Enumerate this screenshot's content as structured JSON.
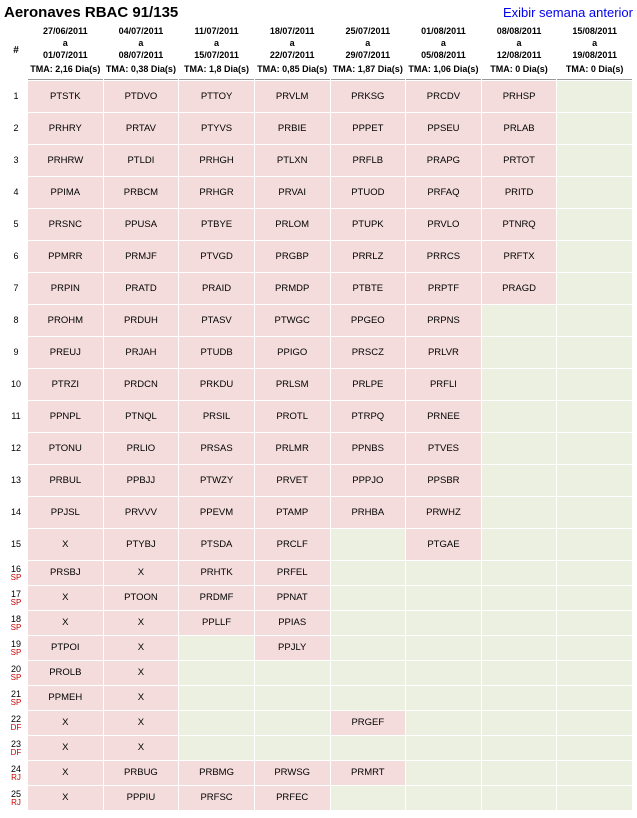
{
  "title": "Aeronaves RBAC 91/135",
  "prev_link": "Exibir semana anterior",
  "columns": [
    {
      "from": "27/06/2011",
      "to": "01/07/2011",
      "tma": "TMA: 2,16 Dia(s)"
    },
    {
      "from": "04/07/2011",
      "to": "08/07/2011",
      "tma": "TMA: 0,38 Dia(s)"
    },
    {
      "from": "11/07/2011",
      "to": "15/07/2011",
      "tma": "TMA: 1,8 Dia(s)"
    },
    {
      "from": "18/07/2011",
      "to": "22/07/2011",
      "tma": "TMA: 0,85 Dia(s)"
    },
    {
      "from": "25/07/2011",
      "to": "29/07/2011",
      "tma": "TMA: 1,87 Dia(s)"
    },
    {
      "from": "01/08/2011",
      "to": "05/08/2011",
      "tma": "TMA: 1,06 Dia(s)"
    },
    {
      "from": "08/08/2011",
      "to": "12/08/2011",
      "tma": "TMA: 0 Dia(s)"
    },
    {
      "from": "15/08/2011",
      "to": "19/08/2011",
      "tma": "TMA: 0 Dia(s)"
    }
  ],
  "rows": [
    {
      "n": "1",
      "reg": "",
      "size": "big",
      "cells": [
        "PTSTK",
        "PTDVO",
        "PTTOY",
        "PRVLM",
        "PRKSG",
        "PRCDV",
        "PRHSP",
        ""
      ]
    },
    {
      "n": "2",
      "reg": "",
      "size": "big",
      "cells": [
        "PRHRY",
        "PRTAV",
        "PTYVS",
        "PRBIE",
        "PPPET",
        "PPSEU",
        "PRLAB",
        ""
      ]
    },
    {
      "n": "3",
      "reg": "",
      "size": "big",
      "cells": [
        "PRHRW",
        "PTLDI",
        "PRHGH",
        "PTLXN",
        "PRFLB",
        "PRAPG",
        "PRTOT",
        ""
      ]
    },
    {
      "n": "4",
      "reg": "",
      "size": "big",
      "cells": [
        "PPIMA",
        "PRBCM",
        "PRHGR",
        "PRVAI",
        "PTUOD",
        "PRFAQ",
        "PRITD",
        ""
      ]
    },
    {
      "n": "5",
      "reg": "",
      "size": "big",
      "cells": [
        "PRSNC",
        "PPUSA",
        "PTBYE",
        "PRLOM",
        "PTUPK",
        "PRVLO",
        "PTNRQ",
        ""
      ]
    },
    {
      "n": "6",
      "reg": "",
      "size": "big",
      "cells": [
        "PPMRR",
        "PRMJF",
        "PTVGD",
        "PRGBP",
        "PRRLZ",
        "PRRCS",
        "PRFTX",
        ""
      ]
    },
    {
      "n": "7",
      "reg": "",
      "size": "big",
      "cells": [
        "PRPIN",
        "PRATD",
        "PRAID",
        "PRMDP",
        "PTBTE",
        "PRPTF",
        "PRAGD",
        ""
      ]
    },
    {
      "n": "8",
      "reg": "",
      "size": "big",
      "cells": [
        "PROHM",
        "PRDUH",
        "PTASV",
        "PTWGC",
        "PPGEO",
        "PRPNS",
        "",
        ""
      ]
    },
    {
      "n": "9",
      "reg": "",
      "size": "big",
      "cells": [
        "PREUJ",
        "PRJAH",
        "PTUDB",
        "PPIGO",
        "PRSCZ",
        "PRLVR",
        "",
        ""
      ]
    },
    {
      "n": "10",
      "reg": "",
      "size": "big",
      "cells": [
        "PTRZI",
        "PRDCN",
        "PRKDU",
        "PRLSM",
        "PRLPE",
        "PRFLI",
        "",
        ""
      ]
    },
    {
      "n": "11",
      "reg": "",
      "size": "big",
      "cells": [
        "PPNPL",
        "PTNQL",
        "PRSIL",
        "PROTL",
        "PTRPQ",
        "PRNEE",
        "",
        ""
      ]
    },
    {
      "n": "12",
      "reg": "",
      "size": "big",
      "cells": [
        "PTONU",
        "PRLIO",
        "PRSAS",
        "PRLMR",
        "PPNBS",
        "PTVES",
        "",
        ""
      ]
    },
    {
      "n": "13",
      "reg": "",
      "size": "big",
      "cells": [
        "PRBUL",
        "PPBJJ",
        "PTWZY",
        "PRVET",
        "PPPJO",
        "PPSBR",
        "",
        ""
      ]
    },
    {
      "n": "14",
      "reg": "",
      "size": "big",
      "cells": [
        "PPJSL",
        "PRVVV",
        "PPEVM",
        "PTAMP",
        "PRHBA",
        "PRWHZ",
        "",
        ""
      ]
    },
    {
      "n": "15",
      "reg": "",
      "size": "big",
      "cells": [
        "X",
        "PTYBJ",
        "PTSDA",
        "PRCLF",
        "",
        "PTGAE",
        "",
        ""
      ]
    },
    {
      "n": "16",
      "reg": "SP",
      "size": "small",
      "cells": [
        "PRSBJ",
        "X",
        "PRHTK",
        "PRFEL",
        "",
        "",
        "",
        ""
      ]
    },
    {
      "n": "17",
      "reg": "SP",
      "size": "small",
      "cells": [
        "X",
        "PTOON",
        "PRDMF",
        "PPNAT",
        "",
        "",
        "",
        ""
      ]
    },
    {
      "n": "18",
      "reg": "SP",
      "size": "small",
      "cells": [
        "X",
        "X",
        "PPLLF",
        "PPIAS",
        "",
        "",
        "",
        ""
      ]
    },
    {
      "n": "19",
      "reg": "SP",
      "size": "small",
      "cells": [
        "PTPOI",
        "X",
        "",
        "PPJLY",
        "",
        "",
        "",
        ""
      ]
    },
    {
      "n": "20",
      "reg": "SP",
      "size": "small",
      "cells": [
        "PROLB",
        "X",
        "",
        "",
        "",
        "",
        "",
        ""
      ]
    },
    {
      "n": "21",
      "reg": "SP",
      "size": "small",
      "cells": [
        "PPMEH",
        "X",
        "",
        "",
        "",
        "",
        "",
        ""
      ]
    },
    {
      "n": "22",
      "reg": "DF",
      "size": "small",
      "cells": [
        "X",
        "X",
        "",
        "",
        "PRGEF",
        "",
        "",
        ""
      ]
    },
    {
      "n": "23",
      "reg": "DF",
      "size": "small",
      "cells": [
        "X",
        "X",
        "",
        "",
        "",
        "",
        "",
        ""
      ]
    },
    {
      "n": "24",
      "reg": "RJ",
      "size": "small",
      "cells": [
        "X",
        "PRBUG",
        "PRBMG",
        "PRWSG",
        "PRMRT",
        "",
        "",
        ""
      ]
    },
    {
      "n": "25",
      "reg": "RJ",
      "size": "small",
      "cells": [
        "X",
        "PPPIU",
        "PRFSC",
        "PRFEC",
        "",
        "",
        "",
        ""
      ]
    }
  ]
}
